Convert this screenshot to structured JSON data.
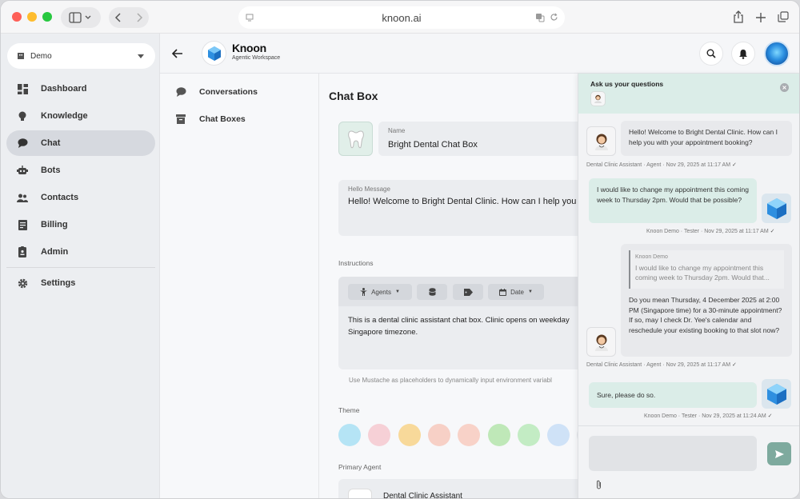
{
  "browser": {
    "url": "knoon.ai"
  },
  "sidebar": {
    "workspace": "Demo",
    "items": [
      {
        "label": "Dashboard",
        "icon": "dashboard-icon"
      },
      {
        "label": "Knowledge",
        "icon": "bulb-icon"
      },
      {
        "label": "Chat",
        "icon": "chat-bubble-icon",
        "active": true
      },
      {
        "label": "Bots",
        "icon": "robot-icon"
      },
      {
        "label": "Contacts",
        "icon": "people-icon"
      },
      {
        "label": "Billing",
        "icon": "receipt-icon"
      },
      {
        "label": "Admin",
        "icon": "badge-icon"
      },
      {
        "label": "Settings",
        "icon": "gear-icon"
      }
    ]
  },
  "header": {
    "brand": "Knoon",
    "tagline": "Agentic Workspace"
  },
  "subnav": {
    "items": [
      {
        "label": "Conversations"
      },
      {
        "label": "Chat Boxes"
      }
    ]
  },
  "main": {
    "title": "Chat Box",
    "name_label": "Name",
    "name_value": "Bright Dental Chat Box",
    "hello_label": "Hello Message",
    "hello_value": "Hello! Welcome to Bright Dental Clinic. How can I help you w",
    "instructions_label": "Instructions",
    "toolbar": {
      "agents": "Agents",
      "date": "Date"
    },
    "instructions_text_1": "This is a dental clinic assistant chat box. Clinic opens on weekday",
    "instructions_text_2": "Singapore timezone.",
    "hint": "Use Mustache as placeholders to dynamically input environment variabl",
    "theme_label": "Theme",
    "theme_colors": [
      "#b5e4f5",
      "#f6d0d6",
      "#f8d99a",
      "#f7d0c6",
      "#f8d2c8",
      "#bfe8b8",
      "#c3ecc4",
      "#cfe2f7",
      "#e3e5ea"
    ],
    "primary_agent_label": "Primary Agent",
    "primary_agent_value": "Dental Clinic Assistant"
  },
  "chat": {
    "title": "Ask us your questions",
    "messages": [
      {
        "text": "Hello! Welcome to Bright Dental Clinic. How can I help you with your appointment booking?",
        "meta": "Dental Clinic Assistant · Agent · Nov 29, 2025 at 11:17 AM"
      },
      {
        "text": "I would like to change my appointment this coming week to Thursday 2pm. Would that be possible?",
        "meta": "Knoon Demo · Tester · Nov 29, 2025 at 11:17 AM"
      },
      {
        "quote_author": "Knoon Demo",
        "quote_text": "I would like to change my appointment this coming week to Thursday 2pm. Would that...",
        "text": "Do you mean Thursday, 4 December 2025 at 2:00 PM (Singapore time) for a 30-minute appointment? If so, may I check Dr. Yee's calendar and reschedule your existing booking to that slot now?",
        "meta": "Dental Clinic Assistant · Agent · Nov 29, 2025 at 11:17 AM"
      },
      {
        "text": "Sure, please do so.",
        "meta": "Knoon Demo · Tester · Nov 29, 2025 at 11:24 AM"
      }
    ]
  }
}
